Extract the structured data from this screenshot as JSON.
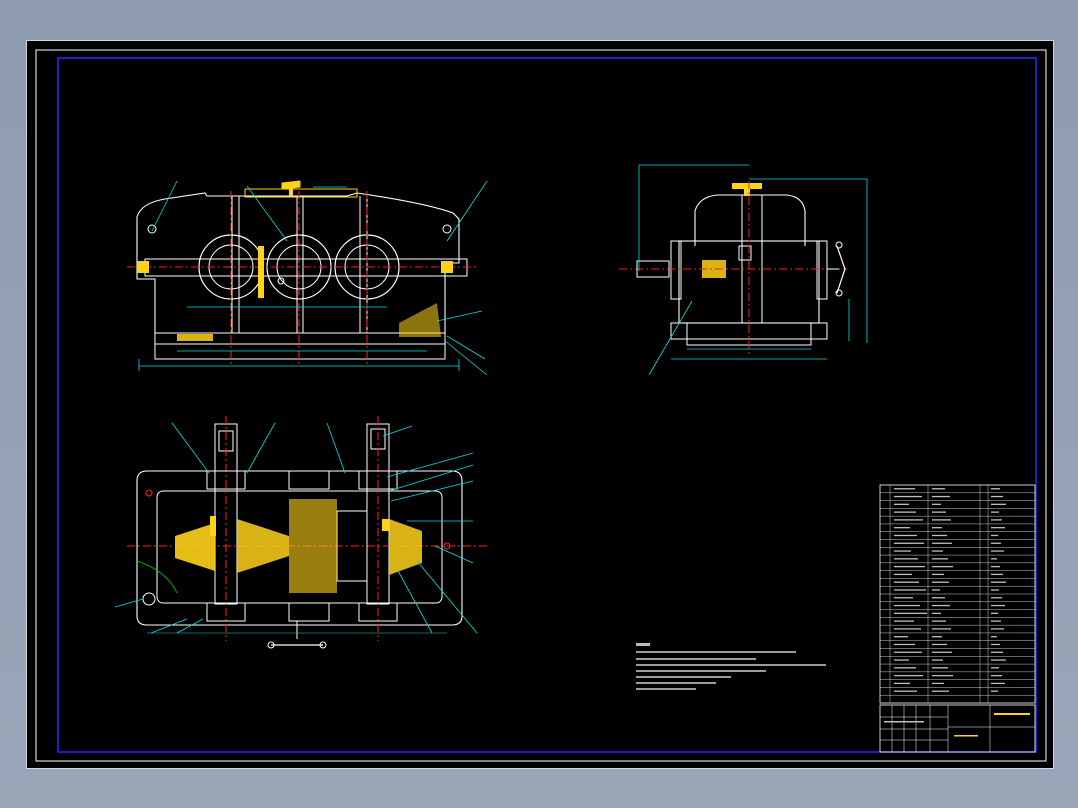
{
  "colors": {
    "background": "#000000",
    "frame_outer": "#ffffff",
    "frame_inner": "#2a2aff",
    "outline": "#ffffff",
    "centerline": "#ff2020",
    "dimension": "#00e0e0",
    "hatch": "#ffd21a",
    "green": "#00d000"
  },
  "views": [
    {
      "id": "front-view",
      "kind": "elevation"
    },
    {
      "id": "side-view",
      "kind": "end-elevation"
    },
    {
      "id": "top-view",
      "kind": "plan-section"
    },
    {
      "id": "tech-notes",
      "kind": "text-block"
    },
    {
      "id": "parts-list",
      "kind": "table"
    },
    {
      "id": "title-block",
      "kind": "table"
    }
  ],
  "parts_list": {
    "rows": 28,
    "columns": 5
  },
  "title_block": {
    "cells": 12
  }
}
